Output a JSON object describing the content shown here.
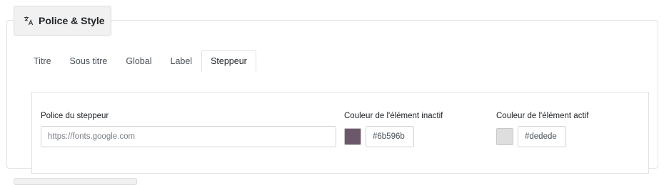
{
  "section": {
    "title": "Police & Style",
    "icon": "translate-icon"
  },
  "tabs": [
    {
      "label": "Titre",
      "active": false
    },
    {
      "label": "Sous titre",
      "active": false
    },
    {
      "label": "Global",
      "active": false
    },
    {
      "label": "Label",
      "active": false
    },
    {
      "label": "Steppeur",
      "active": true
    }
  ],
  "stepper": {
    "font_label": "Police du steppeur",
    "font_placeholder": "https://fonts.google.com",
    "font_value": "",
    "inactive_label": "Couleur de l'élément inactif",
    "inactive_color": "#6b596b",
    "active_label": "Couleur de l'élément actif",
    "active_color": "#dedede"
  }
}
